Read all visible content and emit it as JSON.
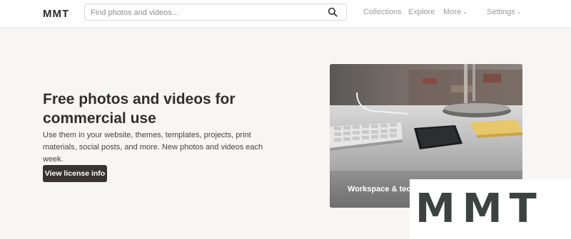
{
  "header": {
    "logo": "MMT",
    "search": {
      "placeholder": "Find photos and videos..."
    },
    "nav": {
      "collections": "Collections",
      "explore": "Explore",
      "more": "More",
      "settings": "Settings"
    }
  },
  "hero": {
    "title": "Free photos and videos for commercial use",
    "description": "Use them in your website, themes, templates, projects, print materials, social posts, and more. New photos and videos each week.",
    "button": "View license info"
  },
  "feature": {
    "caption": "Workspace & tech"
  },
  "watermark": {
    "text": "MMT"
  }
}
